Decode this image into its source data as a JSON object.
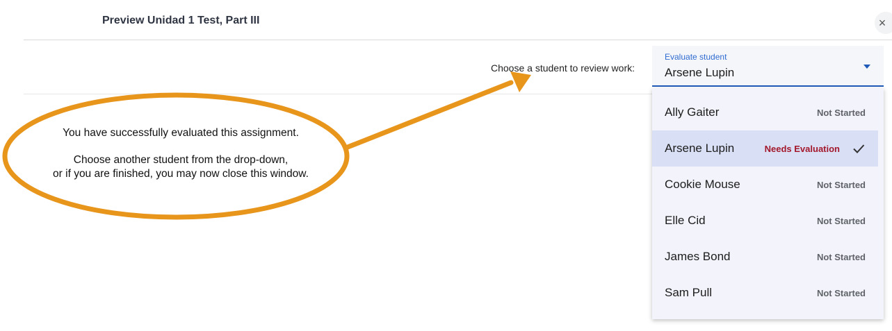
{
  "header": {
    "title": "Preview Unidad 1 Test, Part III",
    "close_icon": "close-icon",
    "close_glyph": "×"
  },
  "student_picker": {
    "prompt": "Choose a student to review work:",
    "field_label": "Evaluate student",
    "selected": "Arsene Lupin",
    "arrow_icon": "caret-down-icon",
    "accent_color": "#1f5ab8"
  },
  "menu": {
    "items": [
      {
        "name": "Ally Gaiter",
        "status": "Not Started"
      },
      {
        "name": "Arsene Lupin",
        "status": "Needs Evaluation",
        "selected": true
      },
      {
        "name": "Cookie Mouse",
        "status": "Not Started"
      },
      {
        "name": "Elle Cid",
        "status": "Not Started"
      },
      {
        "name": "James Bond",
        "status": "Not Started"
      },
      {
        "name": "Sam Pull",
        "status": "Not Started"
      }
    ],
    "check_icon": "check-icon",
    "needs_evaluation_color": "#a3182c"
  },
  "annotation": {
    "line1": "You have successfully evaluated this assignment.",
    "line2": "Choose another student from the drop-down,",
    "line3": "or if you are finished, you may now close this window.",
    "color": "#e8951c"
  }
}
